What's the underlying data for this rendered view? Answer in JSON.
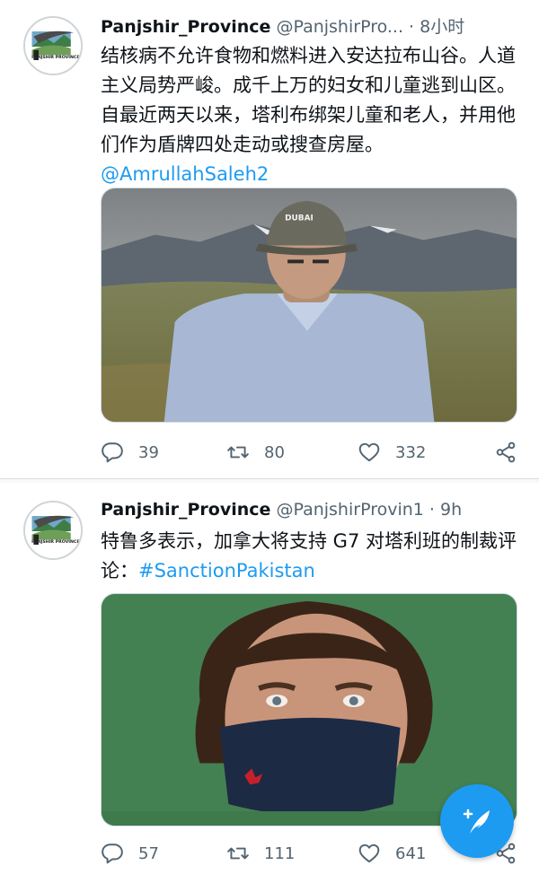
{
  "tweets": [
    {
      "name": "Panjshir_Province",
      "handle": "@PanjshirPro...",
      "separator": "·",
      "time": "8小时",
      "text": "结核病不允许食物和燃料进入安达拉布山谷。人道主义局势严峻。成千上万的妇女和儿童逃到山区。自最近两天以来，塔利布绑架儿童和老人，并用他们作为盾牌四处走动或搜查房屋。",
      "mention": "@AmrullahSaleh2",
      "avatar_logo_text": "PANJSHIR PROVINCE",
      "cap_text": "DUBAI",
      "replies": "39",
      "retweets": "80",
      "likes": "332"
    },
    {
      "name": "Panjshir_Province",
      "handle": "@PanjshirProvin1",
      "separator": "·",
      "time": "9h",
      "text": "特鲁多表示，加拿大将支持 G7 对塔利班的制裁评论：",
      "hashtag": "#SanctionPakistan",
      "avatar_logo_text": "PANJSHIR PROVINCE",
      "replies": "57",
      "retweets": "111",
      "likes": "641"
    }
  ],
  "icons": {
    "reply": "reply-icon",
    "retweet": "retweet-icon",
    "like": "heart-icon",
    "share": "share-icon",
    "compose": "compose-tweet-icon"
  },
  "colors": {
    "accent": "#1d9bf0",
    "text_primary": "#0f1419",
    "text_secondary": "#536471"
  }
}
